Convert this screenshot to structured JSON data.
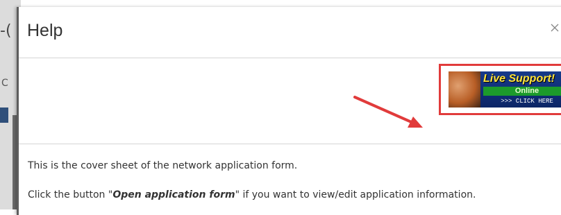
{
  "background": {
    "fragment1": "-(",
    "fragment2": "C"
  },
  "modal": {
    "title": "Help",
    "close_icon": "close-icon",
    "banner": {
      "headline": "Live Support!",
      "status": "Online",
      "cta": ">>> CLICK HERE"
    },
    "annotation": {
      "arrow_icon": "red-arrow-icon",
      "highlight_color": "#e13b3b"
    },
    "body": {
      "line1": "This is the cover sheet of the network application form.",
      "line2_prefix": "Click the button \"",
      "line2_emphasis": "Open application form",
      "line2_suffix": "\" if you want to view/edit application information."
    }
  },
  "colors": {
    "banner_bg": "#163a8a",
    "online_green": "#1c9a2b",
    "headline_yellow": "#ffe33a"
  }
}
